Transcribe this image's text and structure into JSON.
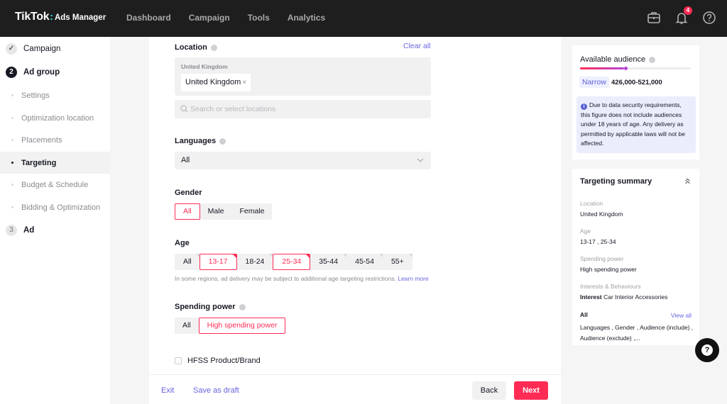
{
  "header": {
    "brand": "TikTok",
    "product": "Ads Manager",
    "nav": [
      "Dashboard",
      "Campaign",
      "Tools",
      "Analytics"
    ],
    "notification_count": "4",
    "icons": [
      "briefcase-icon",
      "bell-icon",
      "help-icon"
    ]
  },
  "sidebar": {
    "steps": [
      {
        "marker": "✓",
        "label": "Campaign"
      },
      {
        "marker": "2",
        "label": "Ad group"
      },
      {
        "marker": "3",
        "label": "Ad"
      }
    ],
    "sub_items": [
      {
        "label": "Settings",
        "active": false
      },
      {
        "label": "Optimization location",
        "active": false
      },
      {
        "label": "Placements",
        "active": false
      },
      {
        "label": "Targeting",
        "active": true
      },
      {
        "label": "Budget & Schedule",
        "active": false
      },
      {
        "label": "Bidding & Optimization",
        "active": false
      }
    ]
  },
  "form": {
    "location": {
      "label": "Location",
      "clear_all": "Clear all",
      "group_header": "United Kingdom",
      "selected": [
        "United Kingdom"
      ],
      "remove_glyph": "×",
      "search_placeholder": "Search or select locations"
    },
    "languages": {
      "label": "Languages",
      "value": "All"
    },
    "gender": {
      "label": "Gender",
      "options": [
        "All",
        "Male",
        "Female"
      ],
      "selected": [
        "All"
      ]
    },
    "age": {
      "label": "Age",
      "options": [
        "All",
        "13-17",
        "18-24",
        "25-34",
        "35-44",
        "45-54",
        "55+"
      ],
      "selected": [
        "13-17",
        "25-34"
      ],
      "note": "In some regions, ad delivery may be subject to additional age targeting restrictions.",
      "learn_more": "Learn more"
    },
    "spending_power": {
      "label": "Spending power",
      "options": [
        "All",
        "High spending power"
      ],
      "selected": [
        "High spending power"
      ]
    },
    "hfss": {
      "label": "HFSS Product/Brand",
      "checked": false
    }
  },
  "footer": {
    "exit": "Exit",
    "save_draft": "Save as draft",
    "back": "Back",
    "next": "Next"
  },
  "audience": {
    "title": "Available audience",
    "level_fraction": 0.4,
    "tag": "Narrow",
    "range": "426,000-521,000",
    "info": "Due to data security requirements, this figure does not include audiences under 18 years of age. Any delivery as permitted by applicable laws will not be affected."
  },
  "summary": {
    "title": "Targeting summary",
    "items": [
      {
        "key": "Location",
        "value": "United Kingdom"
      },
      {
        "key": "Age",
        "value": "13-17 , 25-34"
      },
      {
        "key": "Spending power",
        "value": "High spending power"
      },
      {
        "key": "Interests & Behaviours",
        "value_bold": "Interest",
        "value": "Car Interior Accessories"
      }
    ],
    "all_label": "All",
    "view_all": "View all",
    "all_value": "Languages , Gender , Audience (include) , Audience (exclude) ,..."
  },
  "colors": {
    "accent": "#fe2c55",
    "link": "#6a63e0",
    "topbar": "#1e1e1e"
  }
}
